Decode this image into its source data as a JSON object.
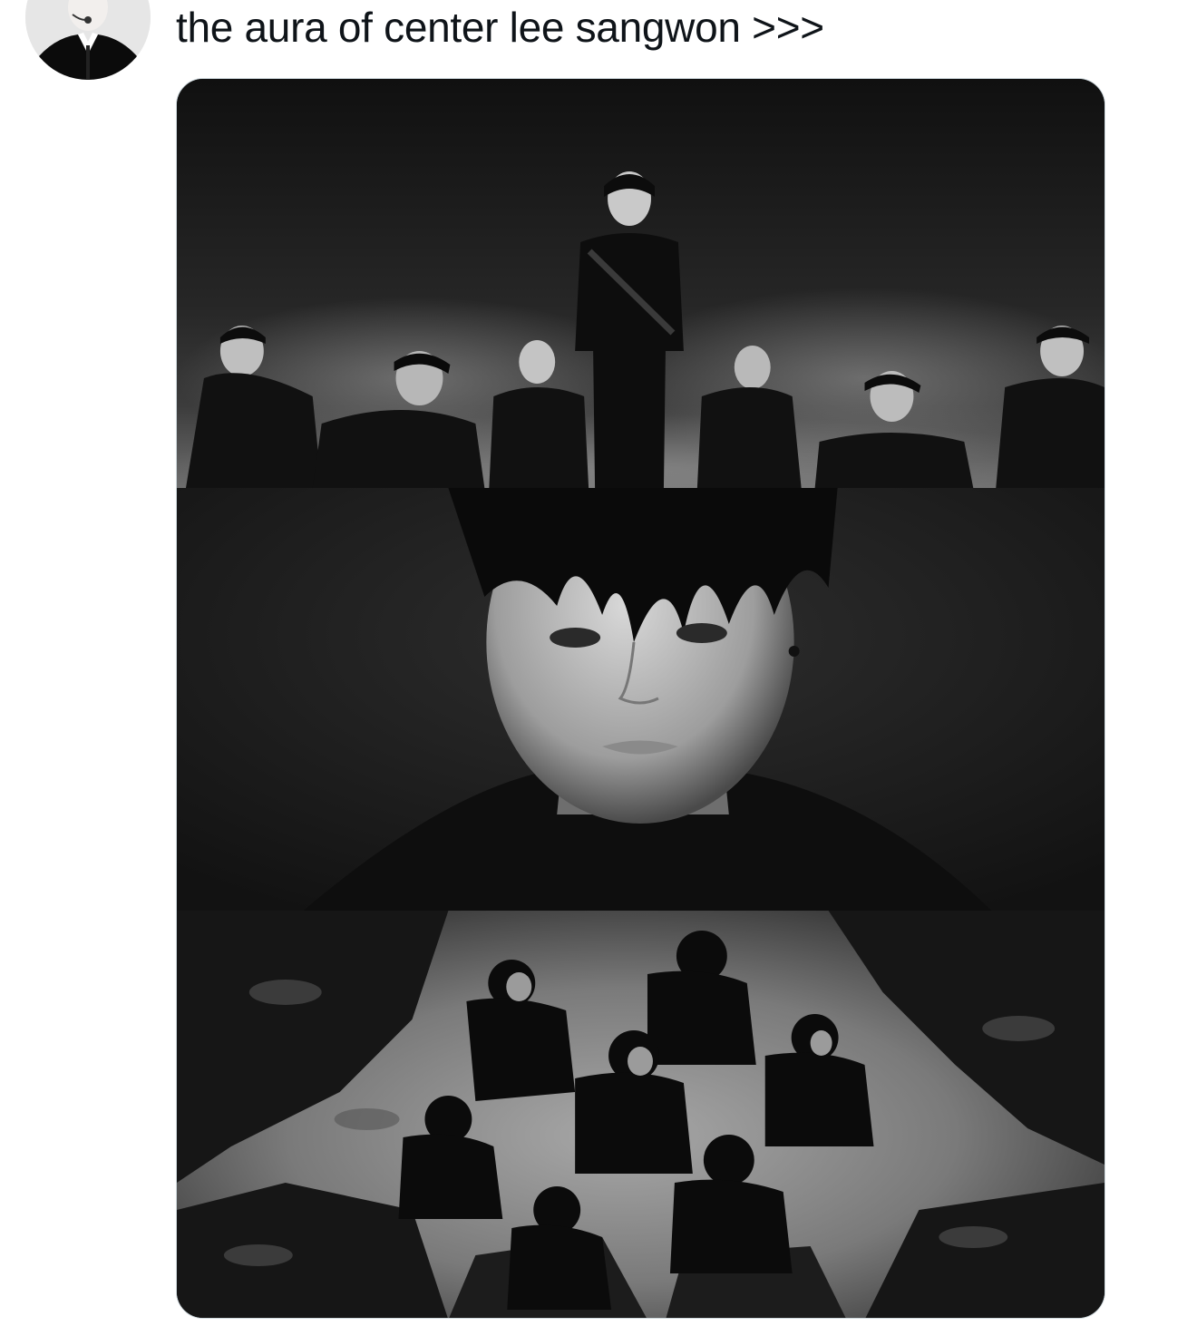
{
  "tweet": {
    "text": "the aura of center lee sangwon >>>",
    "avatar_icon": "profile-avatar-icon"
  },
  "media": {
    "panels": [
      {
        "name": "group-formation-panel",
        "description_icon": "photo-icon"
      },
      {
        "name": "closeup-portrait-panel",
        "description_icon": "photo-icon"
      },
      {
        "name": "overhead-crowd-panel",
        "description_icon": "photo-icon"
      }
    ]
  },
  "colors": {
    "text": "#0f1419",
    "card_border": "#cfd9de",
    "photo_dark": "#141414",
    "photo_light": "#bdbdbd"
  }
}
